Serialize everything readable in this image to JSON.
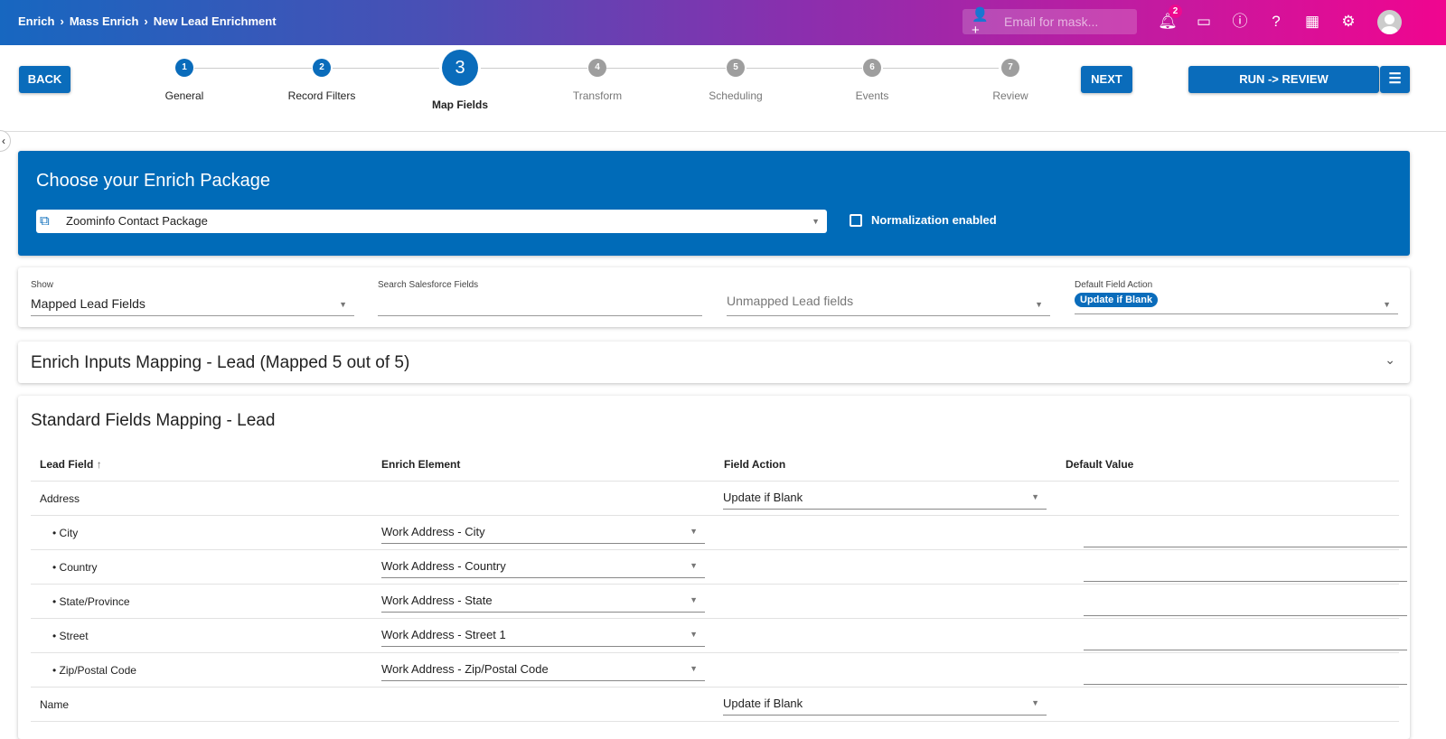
{
  "header": {
    "breadcrumbs": [
      "Enrich",
      "Mass Enrich",
      "New Lead Enrichment"
    ],
    "separator": "›",
    "mask_placeholder": "Email for mask...",
    "notification_count": "2"
  },
  "stepper": {
    "back_label": "BACK",
    "next_label": "NEXT",
    "run_label": "RUN -> REVIEW",
    "steps": [
      {
        "num": "1",
        "label": "General"
      },
      {
        "num": "2",
        "label": "Record Filters"
      },
      {
        "num": "3",
        "label": "Map Fields"
      },
      {
        "num": "4",
        "label": "Transform"
      },
      {
        "num": "5",
        "label": "Scheduling"
      },
      {
        "num": "6",
        "label": "Events"
      },
      {
        "num": "7",
        "label": "Review"
      }
    ]
  },
  "package": {
    "title": "Choose your Enrich Package",
    "selected": "Zoominfo Contact Package",
    "normalization_label": "Normalization enabled"
  },
  "filters": {
    "show_label": "Show",
    "show_value": "Mapped Lead Fields",
    "search_label": "Search Salesforce Fields",
    "search_value": "",
    "unmapped_placeholder": "Unmapped Lead fields",
    "default_action_label": "Default Field Action",
    "default_action_value": "Update if Blank"
  },
  "inputs_mapping": {
    "title": "Enrich Inputs Mapping - Lead (Mapped 5 out of 5)"
  },
  "standard_mapping": {
    "title": "Standard Fields Mapping - Lead",
    "columns": [
      "Lead Field",
      "Enrich Element",
      "Field Action",
      "Default Value"
    ],
    "rows": [
      {
        "field": "Address",
        "element": "",
        "action": "Update if Blank"
      },
      {
        "field": "• City",
        "element": "Work Address - City",
        "action": ""
      },
      {
        "field": "• Country",
        "element": "Work Address - Country",
        "action": ""
      },
      {
        "field": "• State/Province",
        "element": "Work Address - State",
        "action": ""
      },
      {
        "field": "• Street",
        "element": "Work Address - Street 1",
        "action": ""
      },
      {
        "field": "• Zip/Postal Code",
        "element": "Work Address - Zip/Postal Code",
        "action": ""
      },
      {
        "field": "Name",
        "element": "",
        "action": "Update if Blank"
      }
    ]
  }
}
